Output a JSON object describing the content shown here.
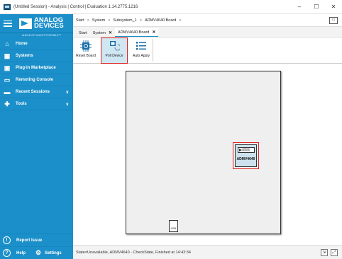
{
  "window": {
    "title": "(Untitled Session) - Analysis | Control | Evaluation 1.14.2775.1216",
    "minimize": "–",
    "maximize": "☐",
    "close": "✕"
  },
  "sidebar": {
    "logo_line1": "ANALOG",
    "logo_line2": "DEVICES",
    "tagline": "AHEAD OF WHAT'S POSSIBLE™",
    "items": [
      {
        "label": "Home",
        "icon": "home-icon"
      },
      {
        "label": "Systems",
        "icon": "systems-icon"
      },
      {
        "label": "Plug-in Marketplace",
        "icon": "marketplace-icon"
      },
      {
        "label": "Remoting Console",
        "icon": "console-icon"
      },
      {
        "label": "Recent Sessions",
        "icon": "recent-sessions-icon"
      },
      {
        "label": "Tools",
        "icon": "tools-icon"
      }
    ],
    "report_issue": "Report Issue",
    "help": "Help",
    "settings": "Settings",
    "colors": {
      "background": "#1b8fc9"
    }
  },
  "breadcrumb": {
    "items": [
      "Start",
      "System",
      "Subsystem_1",
      "ADMV4640 Board"
    ],
    "separator": ">"
  },
  "tabs": [
    {
      "label": "Start",
      "closable": false
    },
    {
      "label": "System",
      "closable": true
    },
    {
      "label": "ADMV4640 Board",
      "closable": true
    }
  ],
  "toolbar": {
    "reset_board": "Reset Board",
    "poll_device": "Poll Device",
    "auto_apply": "Auto Apply"
  },
  "board": {
    "chip_logo_line1": "ANALOG",
    "chip_logo_line2": "DEVICES",
    "chip_name": "ADMV4640",
    "usb_label": "USB"
  },
  "status": {
    "text": "State=Unavailable, ADMV4640 - CheckState, Finished at 14:43:34"
  }
}
